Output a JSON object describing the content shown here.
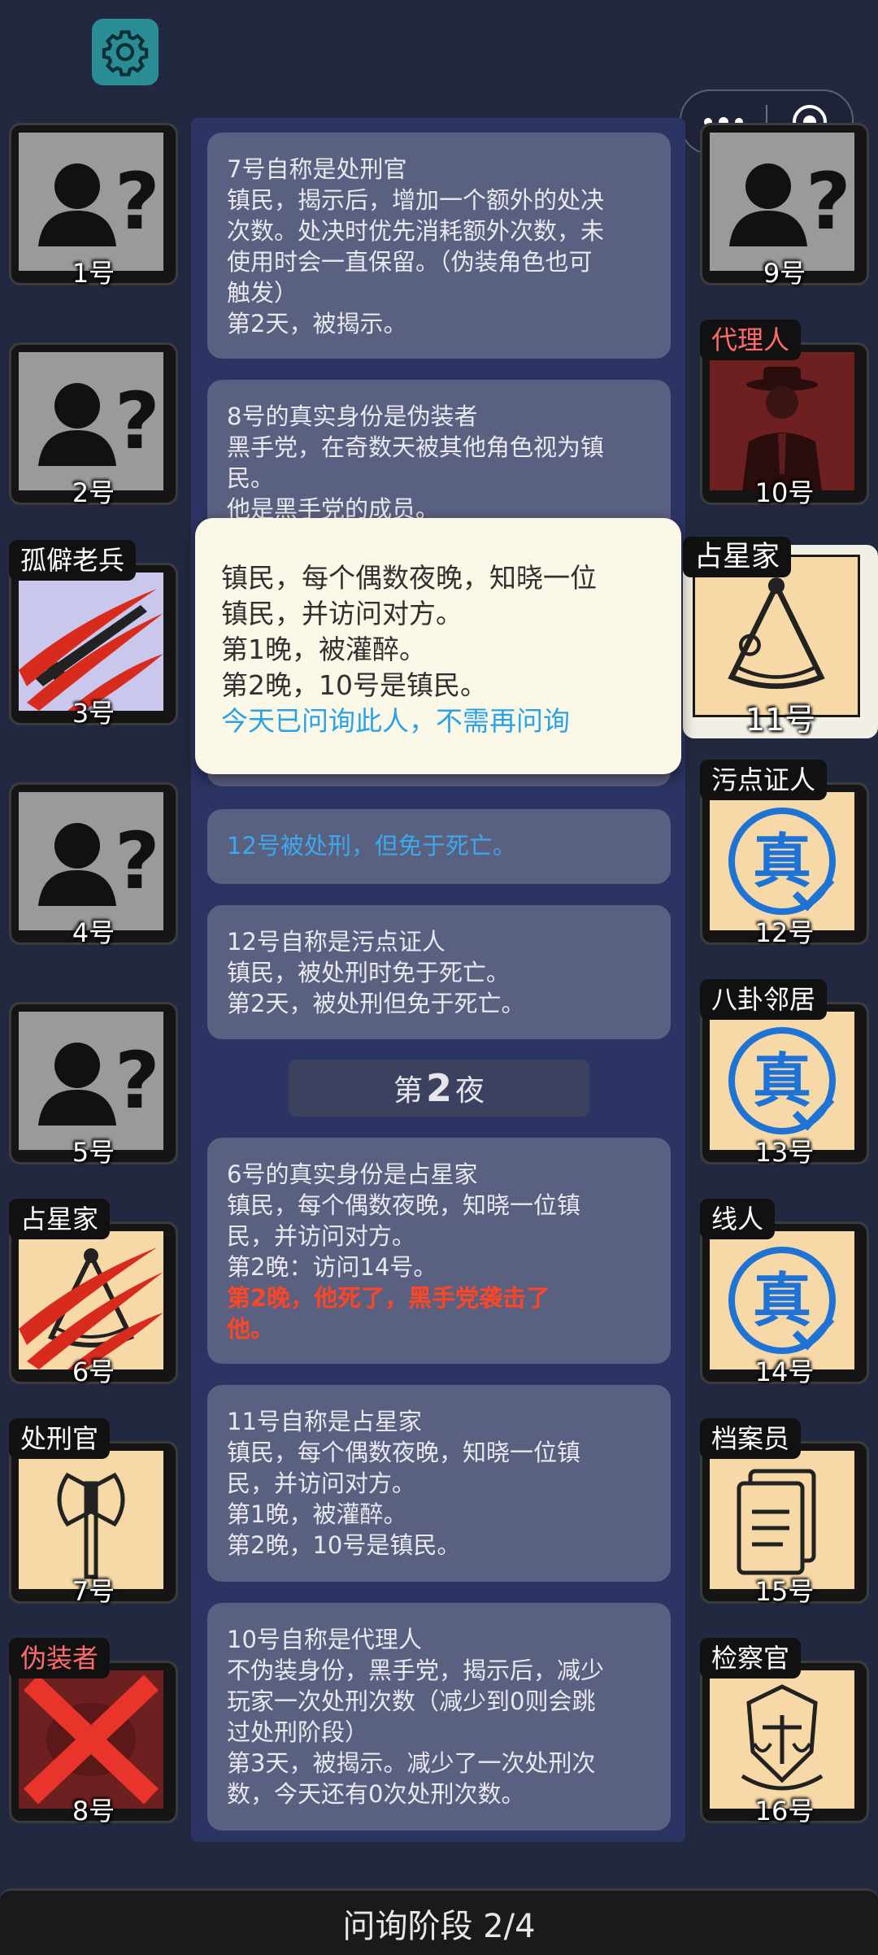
{
  "feed": {
    "card1": [
      "7号自称是处刑官",
      "镇民，揭示后，增加一个额外的处决",
      "次数。处决时优先消耗额外次数，未",
      "使用时会一直保留。（伪装角色也可",
      "触发）",
      "第2天，被揭示。"
    ],
    "card2": [
      "8号的真实身份是伪装者",
      "黑手党，在奇数天被其他角色视为镇",
      "民。",
      "他是黑手党的成员。"
    ],
    "card3": "12号被处刑，但免于死亡。",
    "card4": [
      "12号自称是污点证人",
      "镇民，被处刑时免于死亡。",
      "第2天，被处刑但免于死亡。"
    ],
    "night": {
      "prefix": "第",
      "num": "2",
      "suffix": "夜"
    },
    "card5": [
      "6号的真实身份是占星家",
      "镇民，每个偶数夜晚，知晓一位镇",
      "民，并访问对方。",
      "第2晚：访问14号。"
    ],
    "card5_red": [
      "第2晚，他死了，黑手党袭击了",
      "他。"
    ],
    "card6": [
      "11号自称是占星家",
      "镇民，每个偶数夜晚，知晓一位镇",
      "民，并访问对方。",
      "第1晚，被灌醉。",
      "第2晚，10号是镇民。"
    ],
    "card7": [
      "10号自称是代理人",
      "不伪装身份，黑手党，揭示后，减少",
      "玩家一次处刑次数（减少到0则会跳",
      "过处刑阶段）",
      "第3天，被揭示。减少了一次处刑次",
      "数，今天还有0次处刑次数。"
    ]
  },
  "popup": {
    "lines": [
      "镇民，每个偶数夜晚，知晓一位",
      "镇民，并访问对方。",
      "第1晚，被灌醉。",
      "第2晚，10号是镇民。"
    ],
    "note": "今天已问询此人，不需再问询"
  },
  "players_left": [
    {
      "num": "1号",
      "role": "",
      "state": "unknown"
    },
    {
      "num": "2号",
      "role": "",
      "state": "unknown"
    },
    {
      "num": "3号",
      "role": "孤僻老兵",
      "state": "dead",
      "art": "rifle"
    },
    {
      "num": "4号",
      "role": "",
      "state": "unknown"
    },
    {
      "num": "5号",
      "role": "",
      "state": "unknown"
    },
    {
      "num": "6号",
      "role": "占星家",
      "state": "dead",
      "art": "sextant"
    },
    {
      "num": "7号",
      "role": "处刑官",
      "state": "alive",
      "art": "axe"
    },
    {
      "num": "8号",
      "role": "伪装者",
      "state": "executed",
      "art": "mask"
    }
  ],
  "players_right": [
    {
      "num": "9号",
      "role": "",
      "state": "unknown"
    },
    {
      "num": "10号",
      "role": "代理人",
      "state": "mafia",
      "art": "agent"
    },
    {
      "num": "11号",
      "role": "占星家",
      "state": "selected",
      "art": "sextant"
    },
    {
      "num": "12号",
      "role": "污点证人",
      "state": "verified",
      "art": "witness"
    },
    {
      "num": "13号",
      "role": "八卦邻居",
      "state": "verified",
      "art": "neighbor"
    },
    {
      "num": "14号",
      "role": "线人",
      "state": "verified",
      "art": "informant"
    },
    {
      "num": "15号",
      "role": "档案员",
      "state": "alive",
      "art": "docs"
    },
    {
      "num": "16号",
      "role": "检察官",
      "state": "alive",
      "art": "emblem"
    }
  ],
  "verified_glyph": "真",
  "bottom": {
    "label": "问询阶段 2/4"
  },
  "colors": {
    "background": "#222840",
    "feed": "#2c3464",
    "card": "#5a6080",
    "blue": "#3aa9ee",
    "red": "#ff4524",
    "role_card": "#f7d9a8",
    "mafia_card": "#6e2020",
    "unknown_card": "#9a9a9a"
  }
}
